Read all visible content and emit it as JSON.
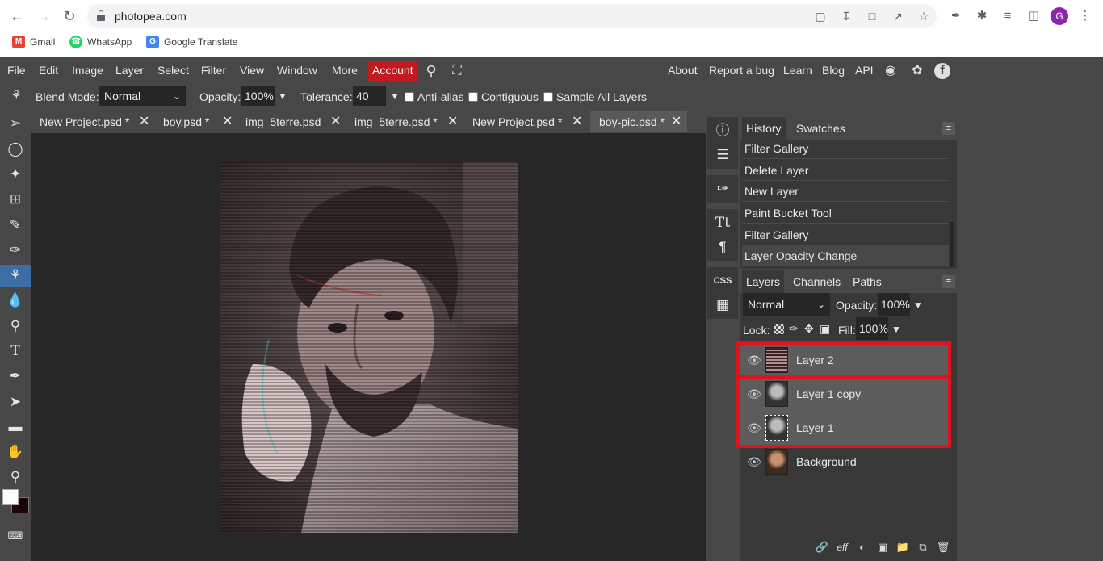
{
  "browser": {
    "url": "photopea.com",
    "bookmarks": [
      {
        "label": "Gmail",
        "icon": "gmail-icon",
        "color": "#ea4335"
      },
      {
        "label": "WhatsApp",
        "icon": "whatsapp-icon",
        "color": "#25d366"
      },
      {
        "label": "Google Translate",
        "icon": "google-translate-icon",
        "color": "#4285f4"
      }
    ],
    "profile_initial": "G"
  },
  "menubar": {
    "items": [
      "File",
      "Edit",
      "Image",
      "Layer",
      "Select",
      "Filter",
      "View",
      "Window",
      "More"
    ],
    "account": "Account",
    "right_links": [
      "About",
      "Report a bug",
      "Learn",
      "Blog",
      "API"
    ],
    "accent_color": "#c4191f"
  },
  "options": {
    "blend_mode_label": "Blend Mode:",
    "blend_mode_value": "Normal",
    "opacity_label": "Opacity:",
    "opacity_value": "100%",
    "tolerance_label": "Tolerance:",
    "tolerance_value": "40",
    "anti_alias": "Anti-alias",
    "contiguous": "Contiguous",
    "sample_all": "Sample All Layers"
  },
  "tabs": [
    {
      "label": "New Project.psd *"
    },
    {
      "label": "boy.psd *"
    },
    {
      "label": "img_5terre.psd"
    },
    {
      "label": "img_5terre.psd *"
    },
    {
      "label": "New Project.psd *"
    },
    {
      "label": "boy-pic.psd *"
    }
  ],
  "history_panel": {
    "tabs": [
      "History",
      "Swatches"
    ],
    "items": [
      "Filter Gallery",
      "Delete Layer",
      "New Layer",
      "Paint Bucket Tool",
      "Filter Gallery",
      "Layer Opacity Change"
    ]
  },
  "layers_panel": {
    "tabs": [
      "Layers",
      "Channels",
      "Paths"
    ],
    "blend_value": "Normal",
    "opacity_label": "Opacity:",
    "opacity_value": "100%",
    "lock_label": "Lock:",
    "fill_label": "Fill:",
    "fill_value": "100%",
    "layers": [
      {
        "name": "Layer 2"
      },
      {
        "name": "Layer 1 copy"
      },
      {
        "name": "Layer 1"
      },
      {
        "name": "Background"
      }
    ],
    "highlight_color": "#e0131d"
  },
  "side_icons": {
    "css_label": "CSS"
  }
}
